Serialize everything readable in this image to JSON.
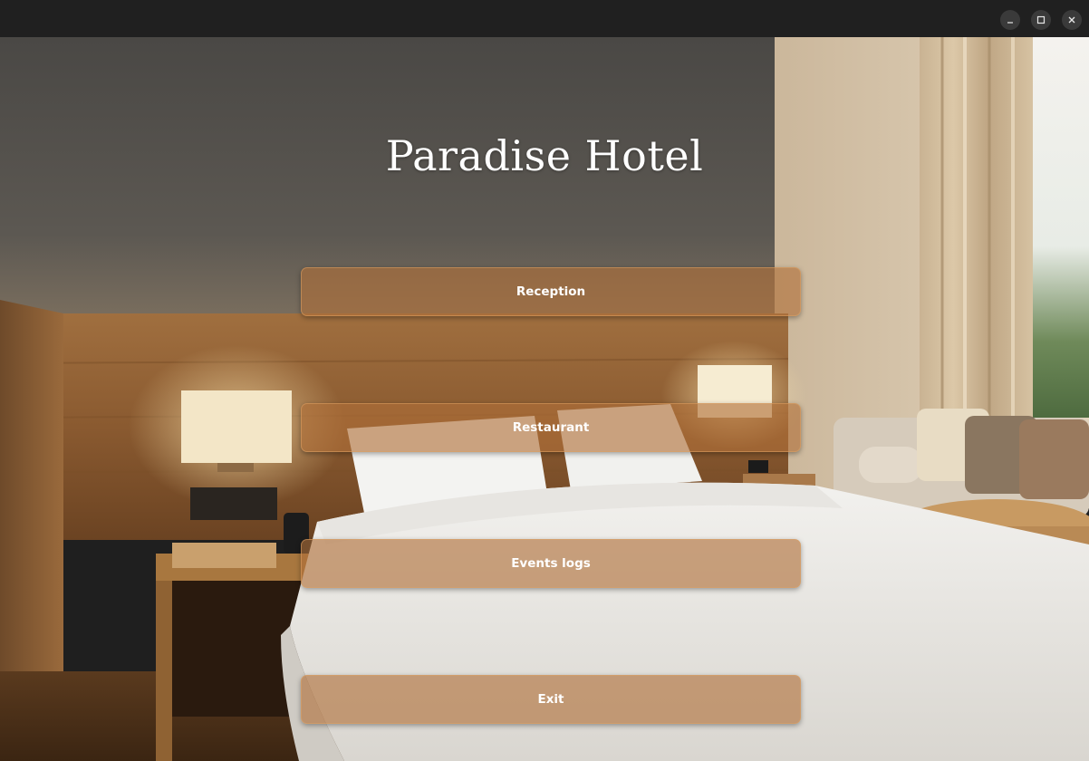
{
  "window": {
    "controls": {
      "minimize": "minimize-icon",
      "maximize": "maximize-icon",
      "close": "close-icon"
    }
  },
  "app": {
    "title": "Paradise Hotel"
  },
  "menu": {
    "reception_label": "Reception",
    "restaurant_label": "Restaurant",
    "events_logs_label": "Events logs",
    "exit_label": "Exit"
  },
  "colors": {
    "button_fill": "#b07038",
    "title_text": "#ffffff",
    "titlebar": "#202020"
  }
}
